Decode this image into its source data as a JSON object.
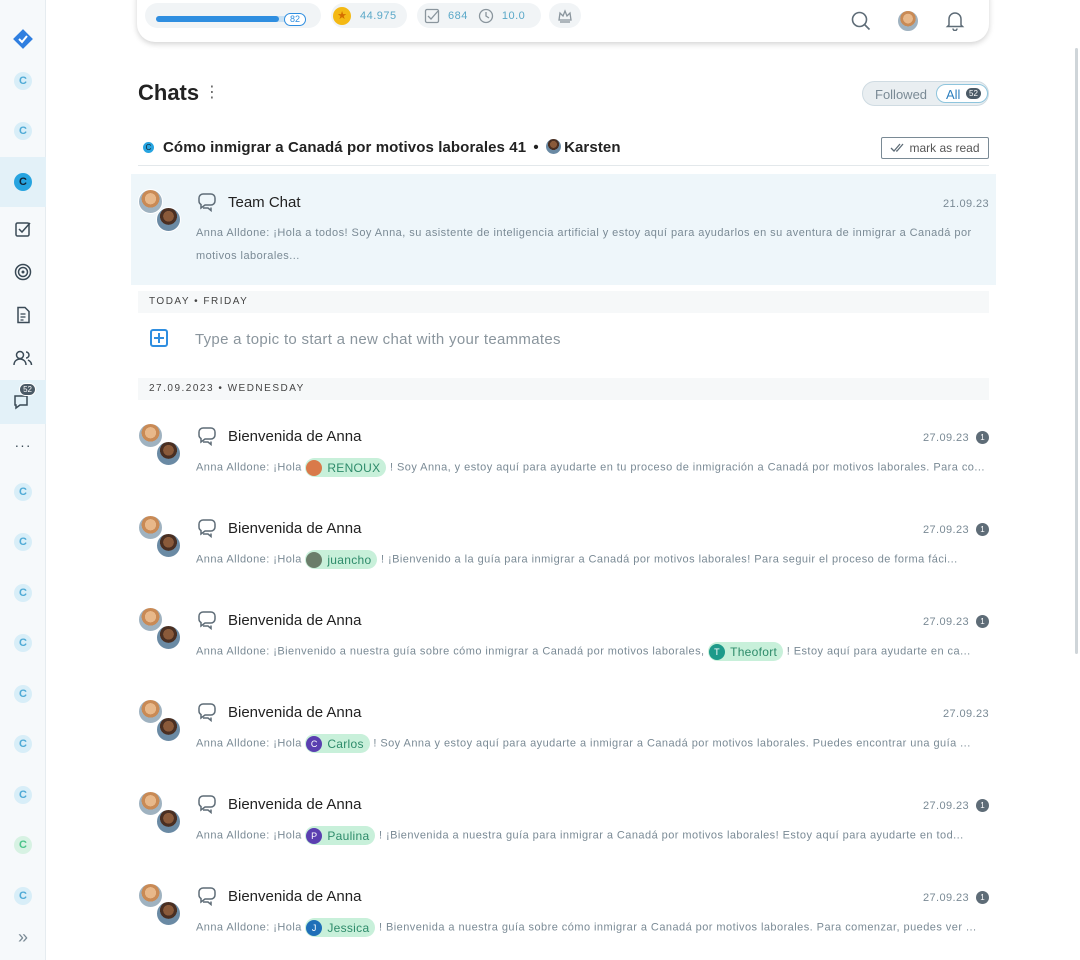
{
  "sidebar": {
    "items": [
      {
        "type": "logo",
        "icon": "checkmark-diamond-icon"
      },
      {
        "type": "circle",
        "label": "C"
      },
      {
        "type": "circle",
        "label": "C"
      },
      {
        "type": "circle",
        "label": "C",
        "active": true
      },
      {
        "type": "icon",
        "icon": "tasks-icon"
      },
      {
        "type": "icon",
        "icon": "target-icon"
      },
      {
        "type": "icon",
        "icon": "document-icon"
      },
      {
        "type": "icon",
        "icon": "people-icon"
      },
      {
        "type": "icon",
        "icon": "chats-icon",
        "badge": "52",
        "active": true
      },
      {
        "type": "icon",
        "icon": "more-icon",
        "label": "···"
      },
      {
        "type": "circle",
        "label": "C"
      },
      {
        "type": "circle",
        "label": "C"
      },
      {
        "type": "circle",
        "label": "C"
      },
      {
        "type": "circle",
        "label": "C"
      },
      {
        "type": "circle",
        "label": "C"
      },
      {
        "type": "circle",
        "label": "C"
      },
      {
        "type": "circle",
        "label": "C"
      },
      {
        "type": "circle",
        "label": "C",
        "color": "green"
      },
      {
        "type": "circle",
        "label": "C"
      },
      {
        "type": "icon",
        "icon": "expand-icon",
        "label": "»"
      }
    ]
  },
  "topbar": {
    "progress_value": "82",
    "progress_fraction": 0.82,
    "coins": "44.975",
    "tasks": "684",
    "time": "10.0",
    "crown_icon": "crown-icon"
  },
  "header": {
    "title": "Chats",
    "filter_followed": "Followed",
    "filter_all": "All",
    "filter_all_count": "52"
  },
  "topic": {
    "badge": "C",
    "title": "Cómo inmigrar a Canadá por motivos laborales 41",
    "separator": "•",
    "owner": "Karsten",
    "mark_read": "mark as read"
  },
  "pinned_chat": {
    "title": "Team Chat",
    "date": "21.09.23",
    "preview": "Anna Alldone: ¡Hola a todos! Soy Anna, su asistente de inteligencia artificial y estoy aquí para ayudarlos en su aventura de inmigrar a Canadá por motivos laborales..."
  },
  "today_label": "TODAY • FRIDAY",
  "new_topic_placeholder": "Type a topic to start a new chat with your teammates",
  "day2_label": "27.09.2023 • WEDNESDAY",
  "chats": [
    {
      "title": "Bienvenida de Anna",
      "date": "27.09.23",
      "unread": "1",
      "pre": "Anna Alldone: ¡Hola",
      "mention": "RENOUX",
      "mention_initial": "",
      "mention_color": "#d97a4a",
      "post": "! Soy Anna, y estoy aquí para ayudarte en tu proceso de inmigración a Canadá por motivos laborales. Para co..."
    },
    {
      "title": "Bienvenida de Anna",
      "date": "27.09.23",
      "unread": "1",
      "pre": "Anna Alldone: ¡Hola",
      "mention": "juancho",
      "mention_initial": "",
      "mention_color": "#6b7d6a",
      "post": "! ¡Bienvenido a la guía para inmigrar a Canadá por motivos laborales! Para seguir el proceso de forma fáci..."
    },
    {
      "title": "Bienvenida de Anna",
      "date": "27.09.23",
      "unread": "1",
      "pre": "Anna Alldone: ¡Bienvenido a nuestra guía sobre cómo inmigrar a Canadá por motivos laborales,",
      "mention": "Theofort",
      "mention_initial": "T",
      "mention_color": "#1e9a8a",
      "post": "! Estoy aquí para ayudarte en ca..."
    },
    {
      "title": "Bienvenida de Anna",
      "date": "27.09.23",
      "unread": "",
      "pre": "Anna Alldone: ¡Hola",
      "mention": "Carlos",
      "mention_initial": "C",
      "mention_color": "#5a3fb0",
      "post": "! Soy Anna y estoy aquí para ayudarte a inmigrar a Canadá por motivos laborales. Puedes encontrar una guía ..."
    },
    {
      "title": "Bienvenida de Anna",
      "date": "27.09.23",
      "unread": "1",
      "pre": "Anna Alldone: ¡Hola",
      "mention": "Paulina",
      "mention_initial": "P",
      "mention_color": "#5a3fb0",
      "post": "! ¡Bienvenida a nuestra guía para inmigrar a Canadá por motivos laborales! Estoy aquí para ayudarte en tod..."
    },
    {
      "title": "Bienvenida de Anna",
      "date": "27.09.23",
      "unread": "1",
      "pre": "Anna Alldone: ¡Hola",
      "mention": "Jessica",
      "mention_initial": "J",
      "mention_color": "#1f6fb8",
      "post": "! Bienvenida a nuestra guía sobre cómo inmigrar a Canadá por motivos laborales. Para comenzar, puedes ver ..."
    }
  ]
}
